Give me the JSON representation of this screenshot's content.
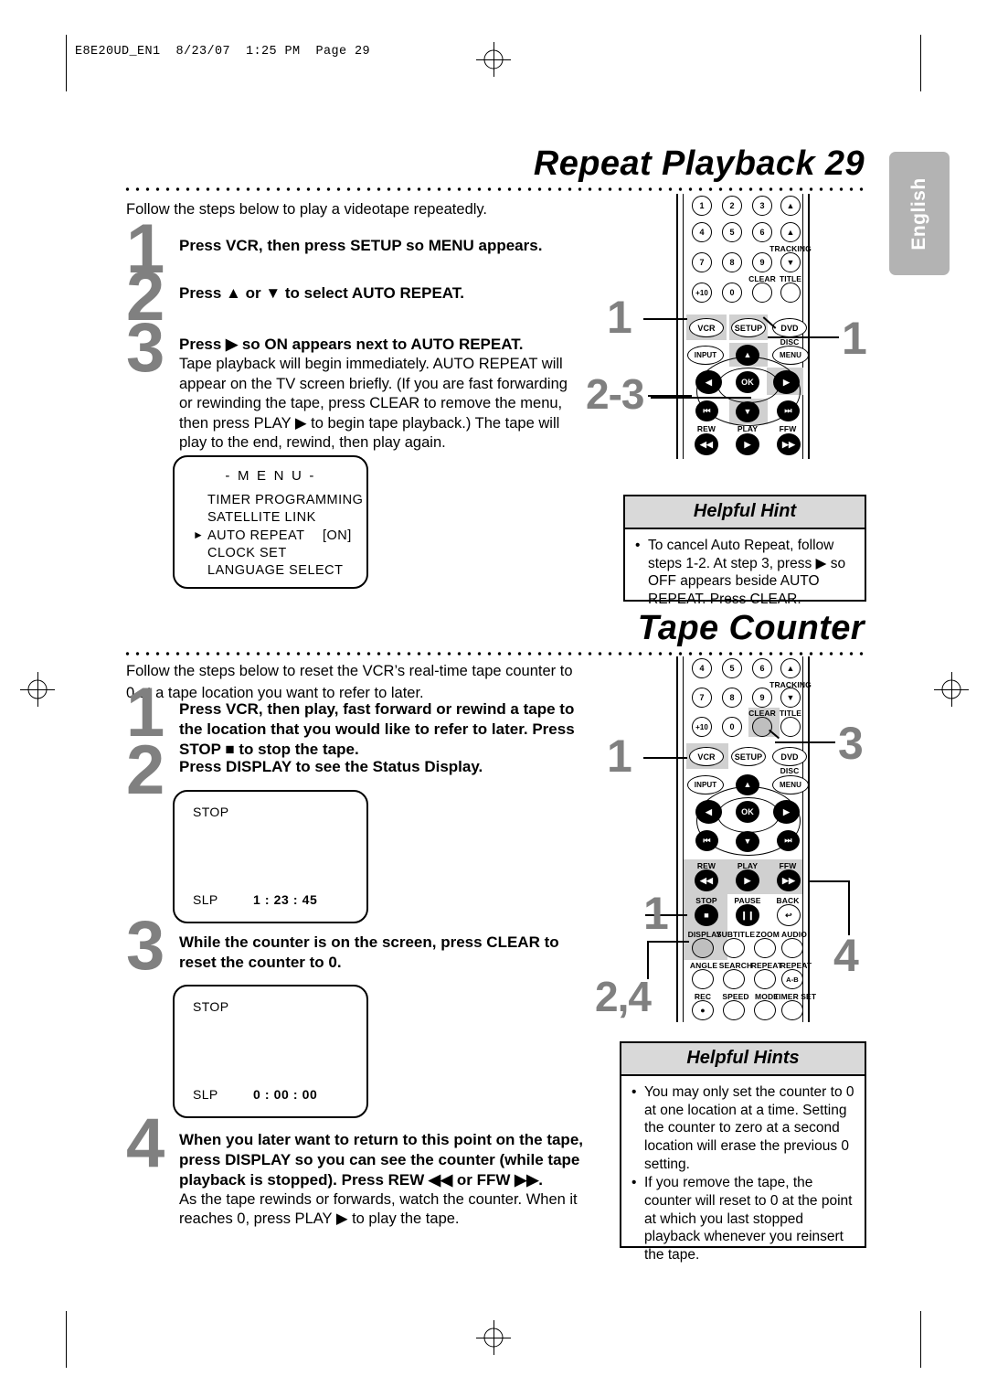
{
  "print_header": "E8E20UD_EN1  8/23/07  1:25 PM  Page 29",
  "side_tab": "English",
  "sections": [
    {
      "id": "repeat-playback",
      "title": "Repeat Playback  29",
      "intro": "Follow the steps below to play a videotape repeatedly.",
      "steps": [
        {
          "number": "1",
          "lead": "Press VCR, then press SETUP so MENU appears.",
          "body": ""
        },
        {
          "number": "2",
          "lead": "Press ▲ or ▼ to select AUTO REPEAT.",
          "body": ""
        },
        {
          "number": "3",
          "lead": "Press ▶ so ON appears next to AUTO REPEAT.",
          "body": "Tape playback will begin immediately. AUTO REPEAT will appear on the TV screen briefly. (If you are fast forwarding or rewinding the tape, press CLEAR to remove the menu, then press PLAY ▶ to begin tape playback.) The tape will play to the end, rewind, then play again."
        }
      ],
      "menu_screen": {
        "title": "- M E N U -",
        "items": [
          {
            "label": "TIMER PROGRAMMING",
            "value": "",
            "selected": false
          },
          {
            "label": "SATELLITE LINK",
            "value": "",
            "selected": false
          },
          {
            "label": "AUTO REPEAT",
            "value": "[ON]",
            "selected": true
          },
          {
            "label": "CLOCK SET",
            "value": "",
            "selected": false
          },
          {
            "label": "LANGUAGE SELECT",
            "value": "",
            "selected": false
          }
        ]
      },
      "hint": {
        "heading": "Helpful Hint",
        "items": [
          "To cancel Auto Repeat, follow steps 1-2.  At step 3, press ▶ so OFF appears beside AUTO REPEAT.  Press CLEAR."
        ]
      },
      "callouts": [
        {
          "label": "1",
          "target": "vcr-button"
        },
        {
          "label": "1",
          "target": "setup-button"
        },
        {
          "label": "2-3",
          "target": "cursor-pad"
        }
      ]
    },
    {
      "id": "tape-counter",
      "title": "Tape Counter",
      "intro": "Follow the steps below to reset the VCR’s real-time tape counter to 0 at a tape location you want to refer to later.",
      "steps": [
        {
          "number": "1",
          "lead": "Press VCR, then play, fast forward or rewind a tape to the location that you would like to refer to later. Press STOP ■ to stop the tape.",
          "body": ""
        },
        {
          "number": "2",
          "lead": "Press DISPLAY to see the Status Display.",
          "body": ""
        },
        {
          "number": "3",
          "lead": "While the counter is on the screen, press CLEAR to reset the counter to 0.",
          "body": ""
        },
        {
          "number": "4",
          "lead": "When you later want to return to this point on the tape, press DISPLAY so you can see the counter (while tape playback is stopped). Press REW ◀◀ or FFW ▶▶.",
          "body": "As the tape rewinds or forwards, watch the counter. When it reaches 0, press PLAY ▶ to play the tape."
        }
      ],
      "status_displays": [
        {
          "mode": "STOP",
          "speed": "SLP",
          "counter": "1 : 23 : 45"
        },
        {
          "mode": "STOP",
          "speed": "SLP",
          "counter": "0 : 00 : 00"
        }
      ],
      "hint": {
        "heading": "Helpful Hints",
        "items": [
          "You may only set the counter to 0 at one location at a time. Setting the counter to zero at a second location will erase the previous 0 setting.",
          "If you remove the tape, the counter will reset to 0 at the point at which you last stopped playback whenever you reinsert the tape."
        ]
      },
      "callouts": [
        {
          "label": "1",
          "target": "vcr-button"
        },
        {
          "label": "3",
          "target": "clear-button"
        },
        {
          "label": "1",
          "target": "stop-button"
        },
        {
          "label": "2,4",
          "target": "display-button"
        },
        {
          "label": "4",
          "target": "ffw-rew-buttons"
        }
      ]
    }
  ],
  "remote_top": {
    "numpad": [
      "1",
      "2",
      "3",
      "4",
      "5",
      "6",
      "7",
      "8",
      "9",
      "+10",
      "0"
    ],
    "tracking_label": "TRACKING",
    "clear_label": "CLEAR",
    "title_label": "TITLE",
    "mode_buttons": [
      "VCR",
      "SETUP",
      "DVD"
    ],
    "disc_label": "DISC",
    "input_label": "INPUT",
    "menu_label": "MENU",
    "ok_label": "OK",
    "transport_labels": [
      "REW",
      "PLAY",
      "FFW"
    ],
    "highlighted": [
      "VCR",
      "SETUP",
      "UP",
      "RIGHT",
      "DOWN"
    ]
  },
  "remote_bottom": {
    "numpad": [
      "4",
      "5",
      "6",
      "7",
      "8",
      "9",
      "+10",
      "0"
    ],
    "tracking_label": "TRACKING",
    "clear_label": "CLEAR",
    "title_label": "TITLE",
    "mode_buttons": [
      "VCR",
      "SETUP",
      "DVD"
    ],
    "disc_label": "DISC",
    "input_label": "INPUT",
    "menu_label": "MENU",
    "ok_label": "OK",
    "transport_labels": [
      "REW",
      "PLAY",
      "FFW"
    ],
    "row_stop": [
      "STOP",
      "PAUSE",
      "BACK"
    ],
    "row_display": [
      "DISPLAY",
      "SUBTITLE",
      "ZOOM",
      "AUDIO"
    ],
    "row_angle": [
      "ANGLE",
      "SEARCH",
      "REPEAT",
      "REPEAT"
    ],
    "repeat_ab": "A-B",
    "row_rec": [
      "REC",
      "SPEED",
      "MODE",
      "TIMER SET"
    ],
    "highlighted": [
      "VCR",
      "CLEAR",
      "REW",
      "PLAY",
      "FFW",
      "STOP",
      "DISPLAY"
    ]
  },
  "colors": {
    "step_number": "#808080",
    "highlight": "#d0d0d0",
    "hint_header": "#d9d9d9",
    "tab": "#b3b3b3"
  }
}
